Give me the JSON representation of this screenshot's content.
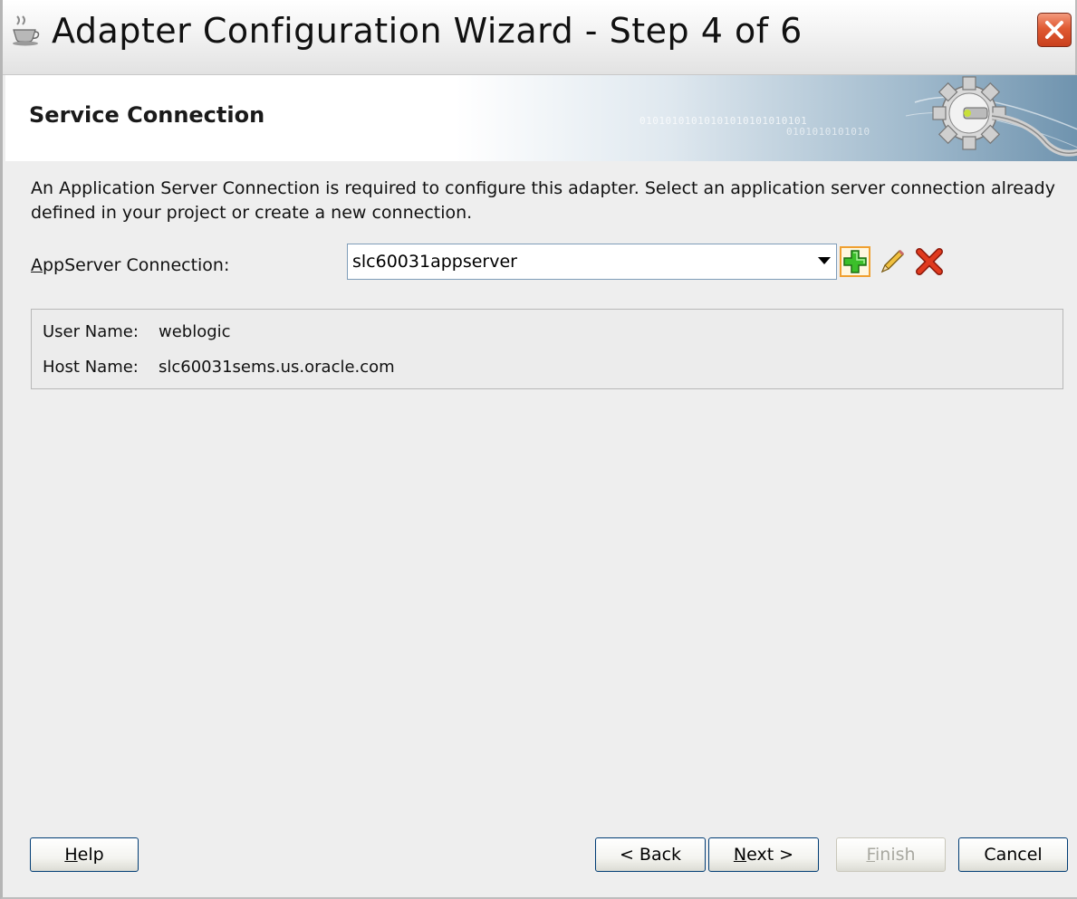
{
  "window": {
    "title": "Adapter Configuration Wizard - Step 4 of 6"
  },
  "header": {
    "title": "Service Connection",
    "binary_row1": "01010101010101010101010101",
    "binary_row2": "0101010101010"
  },
  "content": {
    "description": "An Application Server Connection is required to configure this adapter. Select an application server connection already defined in your project or create a new connection.",
    "appserver_label_mnemonic": "A",
    "appserver_label_rest": "ppServer Connection:",
    "appserver_value": "slc60031appserver",
    "info": {
      "user_name_label": "User Name:",
      "user_name_value": "weblogic",
      "host_name_label": "Host Name:",
      "host_name_value": "slc60031sems.us.oracle.com"
    }
  },
  "buttons": {
    "help": "Help",
    "back": "< Back",
    "next": "Next >",
    "finish": "Finish",
    "cancel": "Cancel"
  },
  "icons": {
    "title": "coffee-cup-icon",
    "add": "add-icon",
    "edit": "pencil-icon",
    "delete": "delete-icon",
    "close": "close-icon"
  }
}
